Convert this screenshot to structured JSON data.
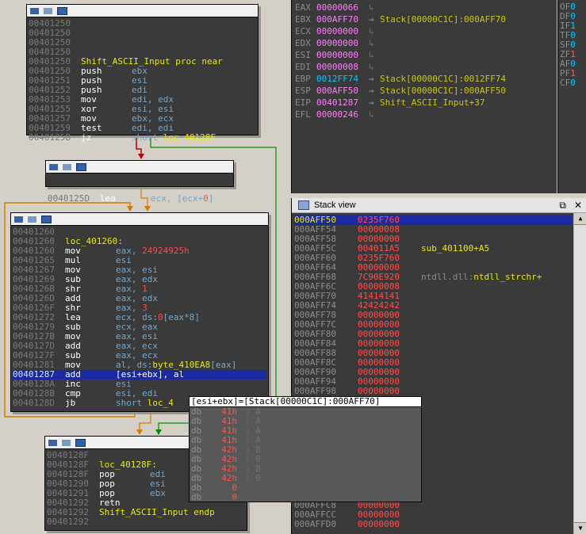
{
  "graph": {
    "node1": {
      "lines": [
        {
          "addr": "00401250",
          "mn": "",
          "op": ""
        },
        {
          "addr": "00401250",
          "mn": "",
          "op": ""
        },
        {
          "addr": "00401250",
          "mn": "",
          "op": ""
        },
        {
          "addr": "00401250",
          "mn": "",
          "op": ""
        },
        {
          "addr": "00401250",
          "proc": "Shift_ASCII_Input proc near"
        },
        {
          "addr": "00401250",
          "mn": "push",
          "op": "ebx"
        },
        {
          "addr": "00401251",
          "mn": "push",
          "op": "esi"
        },
        {
          "addr": "00401252",
          "mn": "push",
          "op": "edi"
        },
        {
          "addr": "00401253",
          "mn": "mov",
          "op": "edi, edx"
        },
        {
          "addr": "00401255",
          "mn": "xor",
          "op": "esi, esi"
        },
        {
          "addr": "00401257",
          "mn": "mov",
          "op": "ebx, ecx"
        },
        {
          "addr": "00401259",
          "mn": "test",
          "op": "edi, edi"
        },
        {
          "addr": "0040125B",
          "mn": "jz",
          "op": "short ",
          "lbl": "loc_40128F"
        }
      ]
    },
    "node2": {
      "addr": "0040125D",
      "mn": "lea",
      "op_a": "ecx, [ecx+",
      "op_num": "0",
      "op_b": "]"
    },
    "node3": {
      "lines": [
        {
          "addr": "00401260",
          "mn": "",
          "op": ""
        },
        {
          "addr": "00401260",
          "label": "loc_401260:"
        },
        {
          "addr": "00401260",
          "mn": "mov",
          "op": "eax, ",
          "num": "24924925h"
        },
        {
          "addr": "00401265",
          "mn": "mul",
          "op": "esi"
        },
        {
          "addr": "00401267",
          "mn": "mov",
          "op": "eax, esi"
        },
        {
          "addr": "00401269",
          "mn": "sub",
          "op": "eax, edx"
        },
        {
          "addr": "0040126B",
          "mn": "shr",
          "op": "eax, ",
          "num": "1"
        },
        {
          "addr": "0040126D",
          "mn": "add",
          "op": "eax, edx"
        },
        {
          "addr": "0040126F",
          "mn": "shr",
          "op": "eax, ",
          "num": "3"
        },
        {
          "addr": "00401272",
          "mn": "lea",
          "op": "ecx, ds:",
          "num": "0",
          "op2": "[eax*8]"
        },
        {
          "addr": "00401279",
          "mn": "sub",
          "op": "ecx, eax"
        },
        {
          "addr": "0040127B",
          "mn": "mov",
          "op": "eax, esi"
        },
        {
          "addr": "0040127D",
          "mn": "add",
          "op": "eax, ecx"
        },
        {
          "addr": "0040127F",
          "mn": "sub",
          "op": "eax, ecx"
        },
        {
          "addr": "00401281",
          "mn": "mov",
          "op": "al, ds:",
          "lbl": "byte_410EA8",
          "op2": "[eax]"
        },
        {
          "addr": "00401287",
          "mn": "add",
          "op": "[esi+ebx], al",
          "sel": true
        },
        {
          "addr": "0040128A",
          "mn": "inc",
          "op": "esi"
        },
        {
          "addr": "0040128B",
          "mn": "cmp",
          "op": "esi, edi"
        },
        {
          "addr": "0040128D",
          "mn": "jb",
          "op": "short ",
          "lbl": "loc_4"
        }
      ]
    },
    "node4": {
      "lines": [
        {
          "addr": "0040128F",
          "mn": "",
          "op": ""
        },
        {
          "addr": "0040128F",
          "label": "loc_40128F:"
        },
        {
          "addr": "0040128F",
          "mn": "pop",
          "op": "edi"
        },
        {
          "addr": "00401290",
          "mn": "pop",
          "op": "esi"
        },
        {
          "addr": "00401291",
          "mn": "pop",
          "op": "ebx"
        },
        {
          "addr": "00401292",
          "mn": "retn",
          "op": ""
        },
        {
          "addr": "00401292",
          "endp": "Shift_ASCII_Input endp"
        },
        {
          "addr": "00401292",
          "mn": "",
          "op": ""
        }
      ]
    }
  },
  "registers": [
    {
      "name": "EAX",
      "value": "00000066",
      "target": ""
    },
    {
      "name": "EBX",
      "value": "000AFF70",
      "target": "Stack[00000C1C]:000AFF70"
    },
    {
      "name": "ECX",
      "value": "00000000",
      "target": ""
    },
    {
      "name": "EDX",
      "value": "00000000",
      "target": ""
    },
    {
      "name": "ESI",
      "value": "00000000",
      "target": ""
    },
    {
      "name": "EDI",
      "value": "00000008",
      "target": ""
    },
    {
      "name": "EBP",
      "value": "0012FF74",
      "target": "Stack[00000C1C]:0012FF74",
      "cyan": true
    },
    {
      "name": "ESP",
      "value": "000AFF50",
      "target": "Stack[00000C1C]:000AFF50"
    },
    {
      "name": "EIP",
      "value": "00401287",
      "target": "Shift_ASCII_Input+37"
    },
    {
      "name": "EFL",
      "value": "00000246",
      "target": ""
    }
  ],
  "flags": [
    {
      "name": "OF",
      "value": "0"
    },
    {
      "name": "DF",
      "value": "0"
    },
    {
      "name": "IF",
      "value": "1"
    },
    {
      "name": "TF",
      "value": "0"
    },
    {
      "name": "SF",
      "value": "0"
    },
    {
      "name": "ZF",
      "value": "1",
      "red": true
    },
    {
      "name": "AF",
      "value": "0"
    },
    {
      "name": "PF",
      "value": "1",
      "red": true
    },
    {
      "name": "CF",
      "value": "0"
    }
  ],
  "stack": {
    "title": "Stack view",
    "restore_glyph": "⧉",
    "close_glyph": "✕",
    "rows": [
      {
        "addr": "000AFF50",
        "val": "0235F760",
        "comment": "",
        "mod": "",
        "sel": true
      },
      {
        "addr": "000AFF54",
        "val": "00000008",
        "comment": "",
        "mod": ""
      },
      {
        "addr": "000AFF58",
        "val": "00000000",
        "comment": "",
        "mod": ""
      },
      {
        "addr": "000AFF5C",
        "val": "004011A5",
        "comment": "sub_401100+A5",
        "mod": ""
      },
      {
        "addr": "000AFF60",
        "val": "0235F760",
        "comment": "",
        "mod": ""
      },
      {
        "addr": "000AFF64",
        "val": "00000000",
        "comment": "",
        "mod": ""
      },
      {
        "addr": "000AFF68",
        "val": "7C90E920",
        "comment": "ntdll_strchr+",
        "mod": "ntdll.dll:"
      },
      {
        "addr": "000AFF6C",
        "val": "00000008",
        "comment": "",
        "mod": ""
      },
      {
        "addr": "000AFF70",
        "val": "41414141",
        "comment": "",
        "mod": ""
      },
      {
        "addr": "000AFF74",
        "val": "42424242",
        "comment": "",
        "mod": ""
      },
      {
        "addr": "000AFF78",
        "val": "00000000",
        "comment": "",
        "mod": ""
      },
      {
        "addr": "000AFF7C",
        "val": "00000000",
        "comment": "",
        "mod": ""
      },
      {
        "addr": "000AFF80",
        "val": "00000000",
        "comment": "",
        "mod": ""
      },
      {
        "addr": "000AFF84",
        "val": "00000000",
        "comment": "",
        "mod": ""
      },
      {
        "addr": "000AFF88",
        "val": "00000000",
        "comment": "",
        "mod": ""
      },
      {
        "addr": "000AFF8C",
        "val": "00000000",
        "comment": "",
        "mod": ""
      },
      {
        "addr": "000AFF90",
        "val": "00000000",
        "comment": "",
        "mod": ""
      },
      {
        "addr": "000AFF94",
        "val": "00000000",
        "comment": "",
        "mod": ""
      },
      {
        "addr": "000AFF98",
        "val": "00000000",
        "comment": "",
        "mod": ""
      }
    ],
    "bottom_rows": [
      {
        "addr": "000AFFC8",
        "val": "00000000"
      },
      {
        "addr": "000AFFCC",
        "val": "00000000"
      },
      {
        "addr": "000AFFD0",
        "val": "00000000"
      }
    ]
  },
  "hint": {
    "title": "[esi+ebx]=[Stack[00000C1C]:000AFF70]",
    "rows": [
      {
        "d": "db",
        "v": "41h",
        "c": "; A"
      },
      {
        "d": "db",
        "v": "41h",
        "c": "; A"
      },
      {
        "d": "db",
        "v": "41h",
        "c": "; A"
      },
      {
        "d": "db",
        "v": "41h",
        "c": "; A"
      },
      {
        "d": "db",
        "v": "42h",
        "c": "; B"
      },
      {
        "d": "db",
        "v": "42h",
        "c": "; B"
      },
      {
        "d": "db",
        "v": "42h",
        "c": "; B"
      },
      {
        "d": "db",
        "v": "42h",
        "c": "; B"
      },
      {
        "d": "db",
        "v": "0",
        "c": ""
      },
      {
        "d": "db",
        "v": "0",
        "c": ""
      }
    ]
  },
  "colors": {
    "pink": "#ff7cff",
    "cyan": "#00c8ff",
    "yellow": "#e8e800",
    "red": "#ff4c4c",
    "select": "#1b2aa0"
  }
}
